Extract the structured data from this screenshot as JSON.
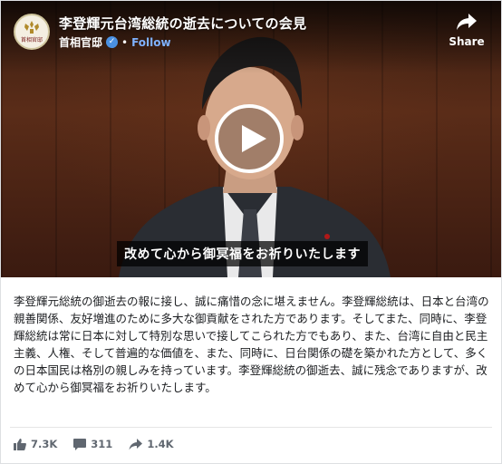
{
  "post": {
    "video_title": "李登輝元台湾総統の逝去についての会見",
    "page_name": "首相官邸",
    "follow_separator": "•",
    "follow_label": "Follow",
    "share_label": "Share",
    "logo_text": "首相官邸",
    "subtitle": "改めて心から御冥福をお祈りいたします",
    "body": "李登輝元総統の御逝去の報に接し、誠に痛惜の念に堪えません。李登輝総統は、日本と台湾の親善関係、友好増進のために多大な御貢献をされた方であります。そしてまた、同時に、李登輝総統は常に日本に対して特別な思いで接してこられた方でもあり、また、台湾に自由と民主主義、人権、そして普遍的な価値を、また、同時に、日台関係の礎を築かれた方として、多くの日本国民は格別の親しみを持っています。李登輝総統の御逝去、誠に残念でありますが、改めて心から御冥福をお祈りいたします。"
  },
  "stats": {
    "likes": "7.3K",
    "comments": "311",
    "shares": "1.4K"
  },
  "colors": {
    "follow": "#7fb2ff",
    "verified": "#4a90e2",
    "text": "#1c1e21",
    "muted": "#606770"
  },
  "icons": [
    "page-logo-emblem",
    "verified-badge-icon",
    "share-arrow-icon",
    "play-icon",
    "like-icon",
    "comment-icon",
    "share-icon"
  ]
}
